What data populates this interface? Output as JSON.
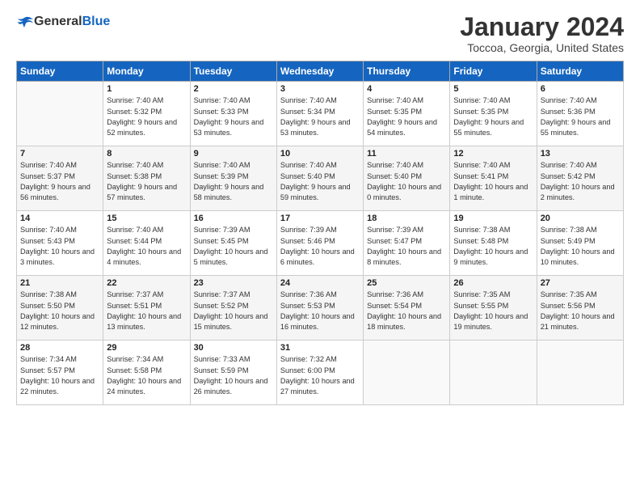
{
  "header": {
    "logo": {
      "general": "General",
      "blue": "Blue"
    },
    "title": "January 2024",
    "location": "Toccoa, Georgia, United States"
  },
  "weekdays": [
    "Sunday",
    "Monday",
    "Tuesday",
    "Wednesday",
    "Thursday",
    "Friday",
    "Saturday"
  ],
  "weeks": [
    [
      {
        "day": "",
        "sunrise": "",
        "sunset": "",
        "daylight": ""
      },
      {
        "day": "1",
        "sunrise": "Sunrise: 7:40 AM",
        "sunset": "Sunset: 5:32 PM",
        "daylight": "Daylight: 9 hours and 52 minutes."
      },
      {
        "day": "2",
        "sunrise": "Sunrise: 7:40 AM",
        "sunset": "Sunset: 5:33 PM",
        "daylight": "Daylight: 9 hours and 53 minutes."
      },
      {
        "day": "3",
        "sunrise": "Sunrise: 7:40 AM",
        "sunset": "Sunset: 5:34 PM",
        "daylight": "Daylight: 9 hours and 53 minutes."
      },
      {
        "day": "4",
        "sunrise": "Sunrise: 7:40 AM",
        "sunset": "Sunset: 5:35 PM",
        "daylight": "Daylight: 9 hours and 54 minutes."
      },
      {
        "day": "5",
        "sunrise": "Sunrise: 7:40 AM",
        "sunset": "Sunset: 5:35 PM",
        "daylight": "Daylight: 9 hours and 55 minutes."
      },
      {
        "day": "6",
        "sunrise": "Sunrise: 7:40 AM",
        "sunset": "Sunset: 5:36 PM",
        "daylight": "Daylight: 9 hours and 55 minutes."
      }
    ],
    [
      {
        "day": "7",
        "sunrise": "Sunrise: 7:40 AM",
        "sunset": "Sunset: 5:37 PM",
        "daylight": "Daylight: 9 hours and 56 minutes."
      },
      {
        "day": "8",
        "sunrise": "Sunrise: 7:40 AM",
        "sunset": "Sunset: 5:38 PM",
        "daylight": "Daylight: 9 hours and 57 minutes."
      },
      {
        "day": "9",
        "sunrise": "Sunrise: 7:40 AM",
        "sunset": "Sunset: 5:39 PM",
        "daylight": "Daylight: 9 hours and 58 minutes."
      },
      {
        "day": "10",
        "sunrise": "Sunrise: 7:40 AM",
        "sunset": "Sunset: 5:40 PM",
        "daylight": "Daylight: 9 hours and 59 minutes."
      },
      {
        "day": "11",
        "sunrise": "Sunrise: 7:40 AM",
        "sunset": "Sunset: 5:40 PM",
        "daylight": "Daylight: 10 hours and 0 minutes."
      },
      {
        "day": "12",
        "sunrise": "Sunrise: 7:40 AM",
        "sunset": "Sunset: 5:41 PM",
        "daylight": "Daylight: 10 hours and 1 minute."
      },
      {
        "day": "13",
        "sunrise": "Sunrise: 7:40 AM",
        "sunset": "Sunset: 5:42 PM",
        "daylight": "Daylight: 10 hours and 2 minutes."
      }
    ],
    [
      {
        "day": "14",
        "sunrise": "Sunrise: 7:40 AM",
        "sunset": "Sunset: 5:43 PM",
        "daylight": "Daylight: 10 hours and 3 minutes."
      },
      {
        "day": "15",
        "sunrise": "Sunrise: 7:40 AM",
        "sunset": "Sunset: 5:44 PM",
        "daylight": "Daylight: 10 hours and 4 minutes."
      },
      {
        "day": "16",
        "sunrise": "Sunrise: 7:39 AM",
        "sunset": "Sunset: 5:45 PM",
        "daylight": "Daylight: 10 hours and 5 minutes."
      },
      {
        "day": "17",
        "sunrise": "Sunrise: 7:39 AM",
        "sunset": "Sunset: 5:46 PM",
        "daylight": "Daylight: 10 hours and 6 minutes."
      },
      {
        "day": "18",
        "sunrise": "Sunrise: 7:39 AM",
        "sunset": "Sunset: 5:47 PM",
        "daylight": "Daylight: 10 hours and 8 minutes."
      },
      {
        "day": "19",
        "sunrise": "Sunrise: 7:38 AM",
        "sunset": "Sunset: 5:48 PM",
        "daylight": "Daylight: 10 hours and 9 minutes."
      },
      {
        "day": "20",
        "sunrise": "Sunrise: 7:38 AM",
        "sunset": "Sunset: 5:49 PM",
        "daylight": "Daylight: 10 hours and 10 minutes."
      }
    ],
    [
      {
        "day": "21",
        "sunrise": "Sunrise: 7:38 AM",
        "sunset": "Sunset: 5:50 PM",
        "daylight": "Daylight: 10 hours and 12 minutes."
      },
      {
        "day": "22",
        "sunrise": "Sunrise: 7:37 AM",
        "sunset": "Sunset: 5:51 PM",
        "daylight": "Daylight: 10 hours and 13 minutes."
      },
      {
        "day": "23",
        "sunrise": "Sunrise: 7:37 AM",
        "sunset": "Sunset: 5:52 PM",
        "daylight": "Daylight: 10 hours and 15 minutes."
      },
      {
        "day": "24",
        "sunrise": "Sunrise: 7:36 AM",
        "sunset": "Sunset: 5:53 PM",
        "daylight": "Daylight: 10 hours and 16 minutes."
      },
      {
        "day": "25",
        "sunrise": "Sunrise: 7:36 AM",
        "sunset": "Sunset: 5:54 PM",
        "daylight": "Daylight: 10 hours and 18 minutes."
      },
      {
        "day": "26",
        "sunrise": "Sunrise: 7:35 AM",
        "sunset": "Sunset: 5:55 PM",
        "daylight": "Daylight: 10 hours and 19 minutes."
      },
      {
        "day": "27",
        "sunrise": "Sunrise: 7:35 AM",
        "sunset": "Sunset: 5:56 PM",
        "daylight": "Daylight: 10 hours and 21 minutes."
      }
    ],
    [
      {
        "day": "28",
        "sunrise": "Sunrise: 7:34 AM",
        "sunset": "Sunset: 5:57 PM",
        "daylight": "Daylight: 10 hours and 22 minutes."
      },
      {
        "day": "29",
        "sunrise": "Sunrise: 7:34 AM",
        "sunset": "Sunset: 5:58 PM",
        "daylight": "Daylight: 10 hours and 24 minutes."
      },
      {
        "day": "30",
        "sunrise": "Sunrise: 7:33 AM",
        "sunset": "Sunset: 5:59 PM",
        "daylight": "Daylight: 10 hours and 26 minutes."
      },
      {
        "day": "31",
        "sunrise": "Sunrise: 7:32 AM",
        "sunset": "Sunset: 6:00 PM",
        "daylight": "Daylight: 10 hours and 27 minutes."
      },
      {
        "day": "",
        "sunrise": "",
        "sunset": "",
        "daylight": ""
      },
      {
        "day": "",
        "sunrise": "",
        "sunset": "",
        "daylight": ""
      },
      {
        "day": "",
        "sunrise": "",
        "sunset": "",
        "daylight": ""
      }
    ]
  ]
}
